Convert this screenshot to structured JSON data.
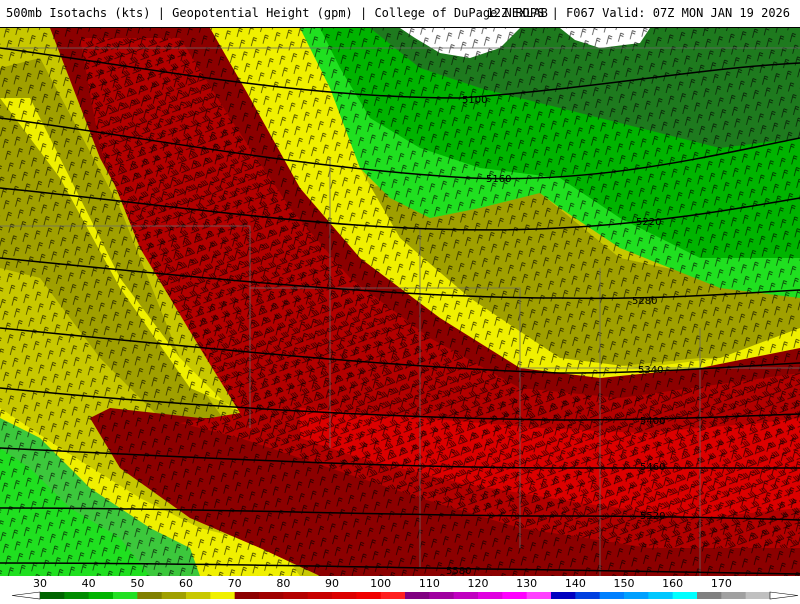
{
  "header": {
    "left_text": "500mb Isotachs (kts) | Geopotential Height (gpm) | College of DuPage NEXLAB",
    "right_text": "12Z RDPS | F067 Valid: 07Z MON JAN 19 2026"
  },
  "map": {
    "contours": [
      {
        "label": "5100"
      },
      {
        "label": "5160"
      },
      {
        "label": "5220"
      },
      {
        "label": "5280"
      },
      {
        "label": "5340"
      },
      {
        "label": "5400"
      },
      {
        "label": "5460"
      },
      {
        "label": "5520"
      },
      {
        "label": "5580"
      }
    ]
  },
  "legend": {
    "ticks": [
      "30",
      "40",
      "50",
      "60",
      "70",
      "80",
      "90",
      "100",
      "110",
      "120",
      "130",
      "140",
      "150",
      "160",
      "170"
    ],
    "colors": [
      "#006400",
      "#008c00",
      "#00b400",
      "#22e022",
      "#808000",
      "#a0a000",
      "#c8c800",
      "#f0f000",
      "#8c0000",
      "#a00000",
      "#b40000",
      "#c80000",
      "#dc0000",
      "#f00000",
      "#ff2020",
      "#800080",
      "#a000a0",
      "#c000c0",
      "#e000e0",
      "#ff00ff",
      "#ff40ff",
      "#0000c0",
      "#0040e0",
      "#0080ff",
      "#00a0ff",
      "#00c8ff",
      "#00ffff",
      "#808080",
      "#a0a0a0",
      "#c0c0c0"
    ]
  },
  "colors": {
    "green_dark": "#1e7a1e",
    "green_mid": "#3cc83c",
    "green_light": "#20e020",
    "olive": "#8c8c00",
    "yellow_olive": "#c8c800",
    "yellow": "#f0f000",
    "red_dark": "#8c0000",
    "red_mid": "#b40000",
    "red_bright": "#dc0000"
  }
}
